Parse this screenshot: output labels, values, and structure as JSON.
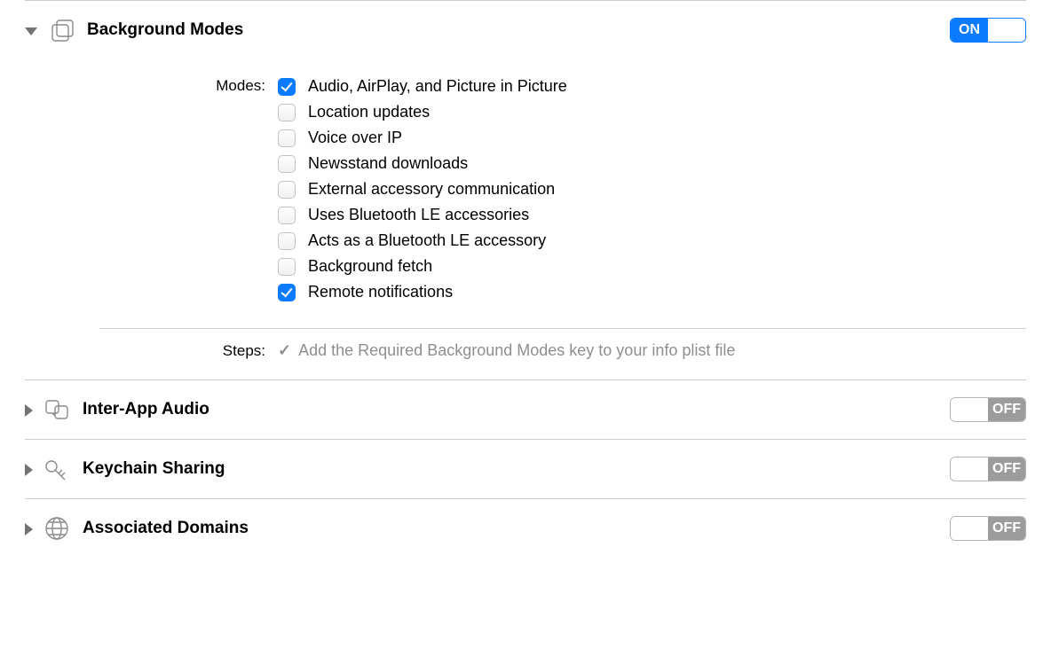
{
  "capabilities": [
    {
      "key": "background-modes",
      "title": "Background Modes",
      "expanded": true,
      "enabled": true
    },
    {
      "key": "inter-app-audio",
      "title": "Inter-App Audio",
      "expanded": false,
      "enabled": false
    },
    {
      "key": "keychain-sharing",
      "title": "Keychain Sharing",
      "expanded": false,
      "enabled": false
    },
    {
      "key": "associated-domains",
      "title": "Associated Domains",
      "expanded": false,
      "enabled": false
    }
  ],
  "switch_labels": {
    "on": "ON",
    "off": "OFF"
  },
  "modes_section": {
    "label": "Modes:",
    "items": [
      {
        "label": "Audio, AirPlay, and Picture in Picture",
        "checked": true
      },
      {
        "label": "Location updates",
        "checked": false
      },
      {
        "label": "Voice over IP",
        "checked": false
      },
      {
        "label": "Newsstand downloads",
        "checked": false
      },
      {
        "label": "External accessory communication",
        "checked": false
      },
      {
        "label": "Uses Bluetooth LE accessories",
        "checked": false
      },
      {
        "label": "Acts as a Bluetooth LE accessory",
        "checked": false
      },
      {
        "label": "Background fetch",
        "checked": false
      },
      {
        "label": "Remote notifications",
        "checked": true
      }
    ]
  },
  "steps_section": {
    "label": "Steps:",
    "checkmark": "✓",
    "text": "Add the Required Background Modes key to your info plist file"
  }
}
